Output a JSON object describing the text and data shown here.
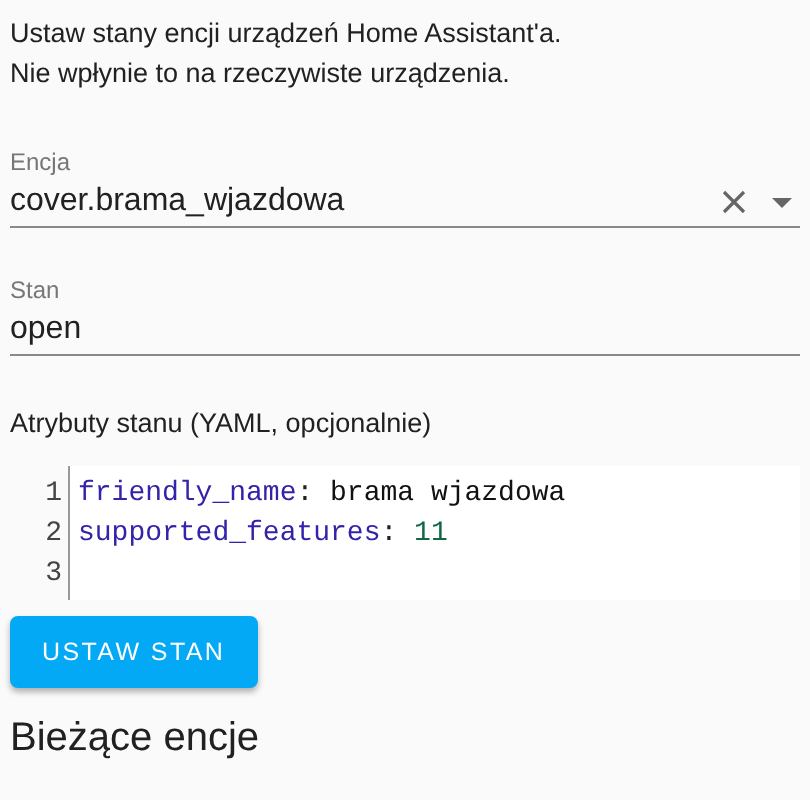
{
  "intro": [
    "Ustaw stany encji urządzeń Home Assistant'a.",
    "Nie wpłynie to na rzeczywiste urządzenia."
  ],
  "entity_field": {
    "label": "Encja",
    "value": "cover.brama_wjazdowa"
  },
  "state_field": {
    "label": "Stan",
    "value": "open"
  },
  "attributes_label": "Atrybuty stanu (YAML, opcjonalnie)",
  "code_editor": {
    "lines": [
      {
        "kind": "string",
        "number": "1",
        "key": "friendly_name",
        "separator": ":",
        "value": "brama wjazdowa"
      },
      {
        "kind": "number",
        "number": "2",
        "key": "supported_features",
        "separator": ":",
        "value": "11"
      },
      {
        "kind": "empty",
        "number": "3"
      }
    ]
  },
  "set_state_button": "USTAW STAN",
  "section_heading": "Bieżące encje"
}
